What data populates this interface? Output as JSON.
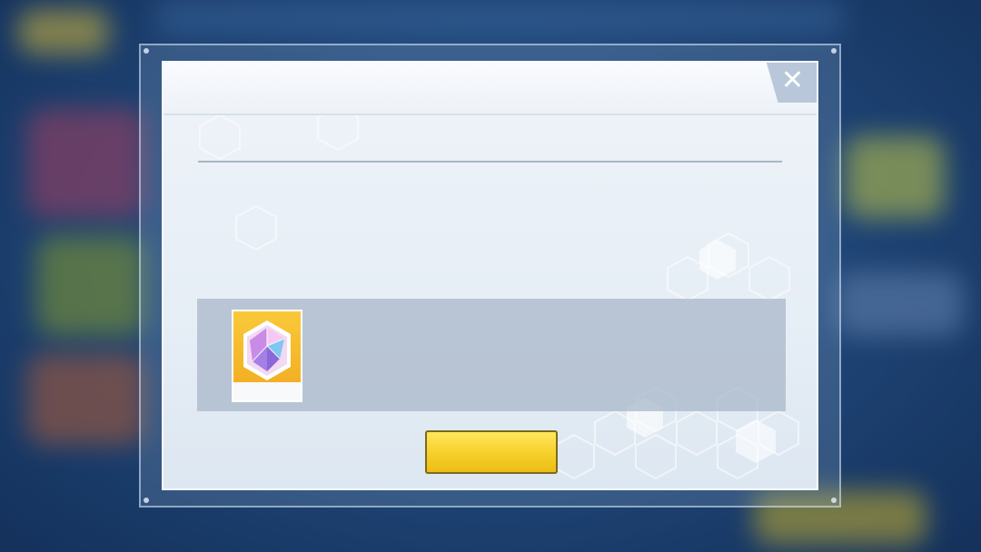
{
  "dialog": {
    "title": "",
    "close_symbol": "✕"
  },
  "mail": {
    "sender_label": "",
    "sender_name": "",
    "date": "",
    "body": ""
  },
  "reward": {
    "icon": "crystal-gem-icon",
    "count": ""
  },
  "claim_button": {
    "label": ""
  },
  "colors": {
    "title_text": "#2f3f52",
    "body_text": "#2f4257",
    "reward_bg": "#f2a91e",
    "claim_button": "#f6cf2a",
    "close_button": "#b8c8da"
  }
}
